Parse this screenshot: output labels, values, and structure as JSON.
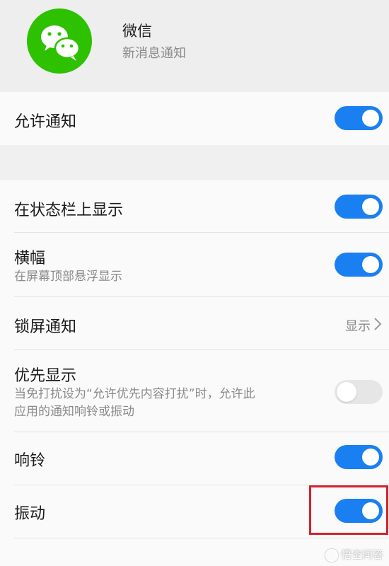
{
  "app": {
    "name": "微信",
    "subtitle": "新消息通知",
    "icon": "wechat-icon",
    "brand_color": "#2dc100"
  },
  "allow_notifications": {
    "label": "允许通知",
    "enabled": true
  },
  "settings": [
    {
      "label": "在状态栏上显示",
      "enabled": true
    },
    {
      "label": "横幅",
      "description": "在屏幕顶部悬浮显示",
      "enabled": true
    },
    {
      "label": "锁屏通知",
      "value": "显示"
    },
    {
      "label": "优先显示",
      "description_line1": "当免打扰设为“允许优先内容打扰”时，允许此",
      "description_line2": "应用的通知响铃或振动",
      "enabled": false
    },
    {
      "label": "响铃",
      "enabled": true
    },
    {
      "label": "振动",
      "enabled": true
    }
  ],
  "colors": {
    "toggle_on": "#1a7ff0",
    "toggle_off": "#e6e6e6",
    "highlight": "#d0232c"
  },
  "watermark": "悟空问答"
}
